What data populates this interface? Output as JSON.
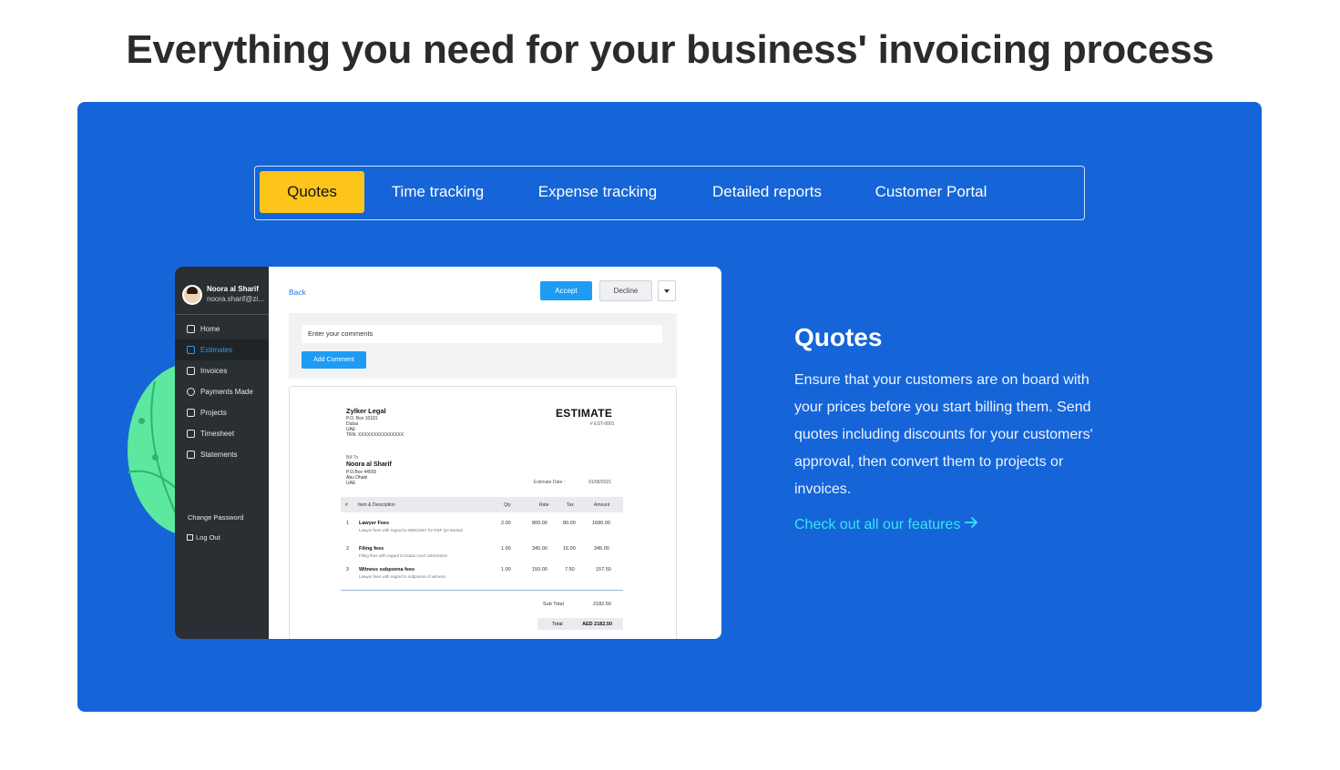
{
  "headline": "Everything you need for your business' invoicing process",
  "colors": {
    "panel": "#1565d8",
    "active_tab": "#fdc51a",
    "link": "#35e6f4",
    "accent_blob": "#5de8a0"
  },
  "tabs": [
    {
      "label": "Quotes",
      "active": true
    },
    {
      "label": "Time tracking",
      "active": false
    },
    {
      "label": "Expense tracking",
      "active": false
    },
    {
      "label": "Detailed reports",
      "active": false
    },
    {
      "label": "Customer Portal",
      "active": false
    }
  ],
  "app": {
    "user": {
      "name": "Noora al Sharif",
      "email": "noora.sharif@zi..."
    },
    "nav": [
      {
        "label": "Home",
        "icon": "home-icon",
        "active": false
      },
      {
        "label": "Estimates",
        "icon": "estimate-icon",
        "active": true
      },
      {
        "label": "Invoices",
        "icon": "invoice-icon",
        "active": false
      },
      {
        "label": "Payments Made",
        "icon": "payment-icon",
        "active": false
      },
      {
        "label": "Projects",
        "icon": "project-icon",
        "active": false
      },
      {
        "label": "Timesheet",
        "icon": "calendar-icon",
        "active": false
      },
      {
        "label": "Statements",
        "icon": "statement-icon",
        "active": false
      }
    ],
    "change_password": "Change Password",
    "logout": "Log Out",
    "back": "Back",
    "accept": "Accept",
    "decline": "Decline",
    "comment_placeholder": "Enter your comments",
    "add_comment": "Add Comment",
    "estimate": {
      "company": "Zylker Legal",
      "company_address": [
        "P.O. Box 10181",
        "Dubai",
        "UAE",
        "TRN: XXXXXXXXXXXXXXX"
      ],
      "title": "ESTIMATE",
      "number": "# EST-0001",
      "bill_to_label": "Bill To",
      "client": "Noora al Sharif",
      "client_address": [
        "P.O.Box 44555",
        "Abu Dhabi",
        "UAE"
      ],
      "date_label": "Estimate Date :",
      "date": "01/06/2021",
      "columns": [
        "#",
        "Item & Description",
        "Qty",
        "Rate",
        "Tax",
        "Amount"
      ],
      "rows": [
        {
          "num": "1",
          "item": "Lawyer Fees",
          "desc": "Lawyer fees with regard to NBS/4487 for DSP Q4 lawsuit",
          "qty": "2.00",
          "rate": "800.00",
          "tax": "80.00",
          "amount": "1680.00"
        },
        {
          "num": "2",
          "item": "Filing fees",
          "desc": "Filing fees with regard to Dubai court submission",
          "qty": "1.00",
          "rate": "345.00",
          "tax": "15.00",
          "amount": "345.00"
        },
        {
          "num": "3",
          "item": "Witness subpoena fees",
          "desc": "Lawyer fees with regard to subpoena of witness",
          "qty": "1.00",
          "rate": "150.00",
          "tax": "7.50",
          "amount": "157.50"
        }
      ],
      "subtotal_label": "Sub Total",
      "subtotal": "2182.50",
      "total_label": "Total",
      "total": "AED 2182.50"
    }
  },
  "feature": {
    "title": "Quotes",
    "body": "Ensure that your customers are on board with your prices before you start billing them. Send quotes including discounts for your customers' approval, then convert them to projects or invoices.",
    "link": "Check out all our features",
    "link_icon": "arrow-right-icon"
  }
}
